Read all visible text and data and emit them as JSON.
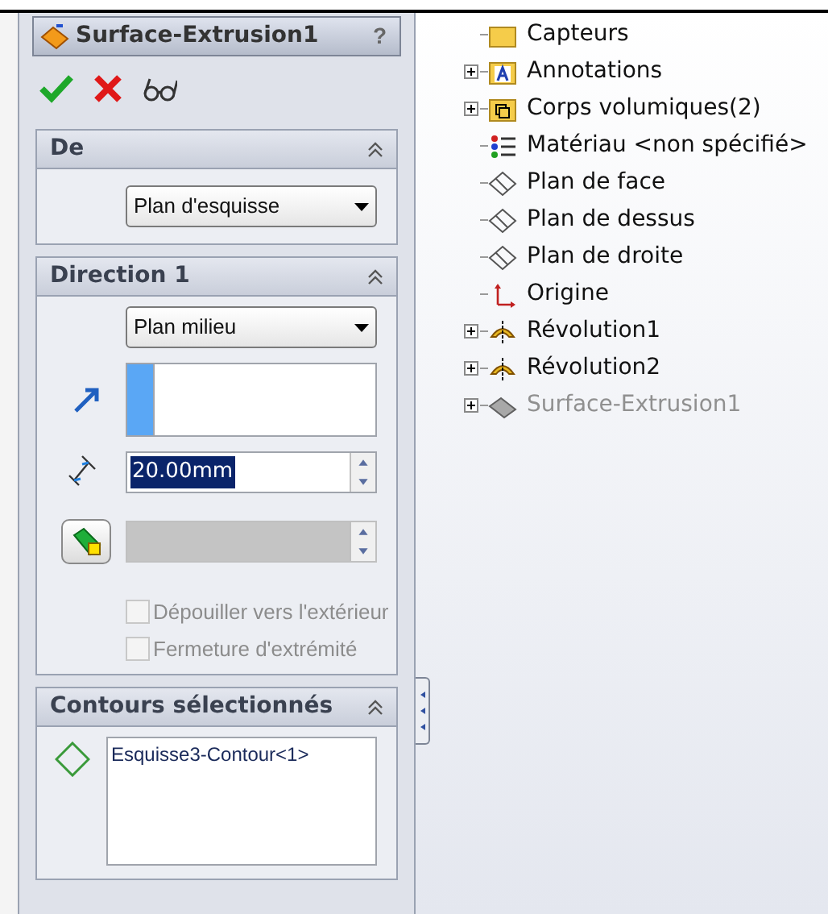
{
  "property_manager": {
    "title": "Surface-Extrusion1",
    "help": "?",
    "sections": [
      {
        "kind": "from",
        "title": "De",
        "expanded": true,
        "dropdown": "Plan d'esquisse"
      },
      {
        "kind": "direction",
        "title": "Direction 1",
        "expanded": true,
        "dropdown": "Plan milieu",
        "depth": {
          "value": "20.00mm",
          "text_selected": true
        },
        "checkboxes": [
          {
            "label": "Dépouiller vers l'extérieur",
            "checked": false,
            "disabled": true
          },
          {
            "label": "Fermeture d'extrémité",
            "checked": false,
            "disabled": true
          }
        ]
      },
      {
        "kind": "contours",
        "title": "Contours sélectionnés",
        "expanded": true,
        "items": [
          "Esquisse3-Contour<1>"
        ]
      }
    ]
  },
  "feature_tree": [
    {
      "kind": "folder",
      "label": "Capteurs",
      "expandable": false,
      "disabled": false
    },
    {
      "kind": "annotations",
      "label": "Annotations",
      "expandable": true,
      "disabled": false
    },
    {
      "kind": "bodies",
      "label": "Corps volumiques(2)",
      "expandable": true,
      "disabled": false
    },
    {
      "kind": "material",
      "label": "Matériau <non spécifié>",
      "expandable": false,
      "disabled": false
    },
    {
      "kind": "plane",
      "label": "Plan de face",
      "expandable": false,
      "disabled": false
    },
    {
      "kind": "plane",
      "label": "Plan de dessus",
      "expandable": false,
      "disabled": false
    },
    {
      "kind": "plane",
      "label": "Plan de droite",
      "expandable": false,
      "disabled": false
    },
    {
      "kind": "origin",
      "label": "Origine",
      "expandable": false,
      "disabled": false
    },
    {
      "kind": "revolve",
      "label": "Révolution1",
      "expandable": true,
      "disabled": false
    },
    {
      "kind": "revolve",
      "label": "Révolution2",
      "expandable": true,
      "disabled": false
    },
    {
      "kind": "surface",
      "label": "Surface-Extrusion1",
      "expandable": true,
      "disabled": true
    }
  ]
}
